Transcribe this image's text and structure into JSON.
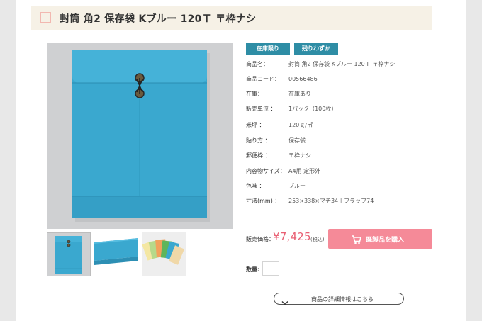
{
  "product": {
    "title": "封筒 角2 保存袋 Kブルー 120Ｔ 〒枠ナシ"
  },
  "badges": [
    "在庫限り",
    "残りわずか"
  ],
  "specs": [
    {
      "label": "商品名：",
      "value": "封筒 角2 保存袋 Kブルー 120Ｔ 〒枠ナシ"
    },
    {
      "label": "商品コード：",
      "value": "00566486"
    },
    {
      "label": "在庫：",
      "value": "在庫あり"
    },
    {
      "label": "販売単位 ：",
      "value": "1パック（100枚）"
    },
    {
      "label": "米坪 ：",
      "value": "120ｇ/㎡"
    },
    {
      "label": "貼り方 ：",
      "value": "保存袋"
    },
    {
      "label": "郵便枠 ：",
      "value": "〒枠ナシ"
    },
    {
      "label": "内容物サイズ：",
      "value": "A4用 定形外"
    },
    {
      "label": "色味 ：",
      "value": "ブルー"
    },
    {
      "label": "寸法(mm) ：",
      "value": "253×338×マチ34＋フラップ74"
    }
  ],
  "price": {
    "label": "販売価格：",
    "value": "¥7,425",
    "tax": "(税込)"
  },
  "buy": {
    "label": "既製品を購入"
  },
  "quantity": {
    "label": "数量:",
    "value": ""
  },
  "detail": {
    "label": "商品の詳細情報はこちら"
  },
  "colors": {
    "accent_teal": "#2e8da5",
    "price_pink": "#e95f73",
    "button_pink": "#f58a98",
    "envelope_blue": "#3aa8cf"
  },
  "icons": [
    "cart-icon",
    "chevron-down-icon"
  ]
}
